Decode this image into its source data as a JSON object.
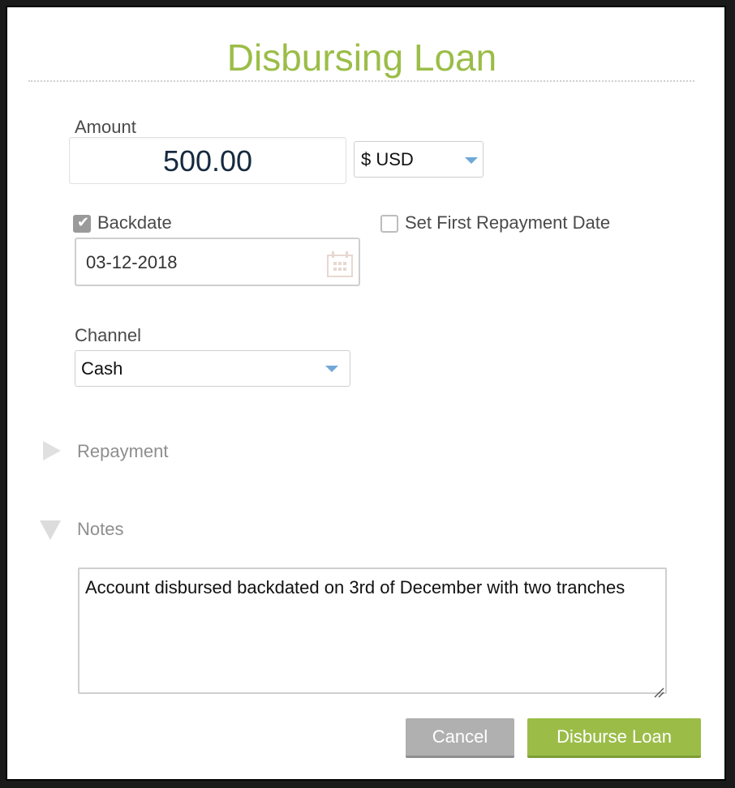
{
  "dialog": {
    "title": "Disbursing Loan"
  },
  "amount": {
    "label": "Amount",
    "value": "500.00"
  },
  "currency": {
    "selected": "$ USD"
  },
  "backdate": {
    "label": "Backdate",
    "checked": true,
    "value": "03-12-2018"
  },
  "first_repayment": {
    "label": "Set First Repayment Date",
    "checked": false
  },
  "channel": {
    "label": "Channel",
    "selected": "Cash"
  },
  "sections": {
    "repayment": {
      "label": "Repayment",
      "expanded": false
    },
    "notes": {
      "label": "Notes",
      "expanded": true
    }
  },
  "notes": {
    "value": "Account disbursed backdated on 3rd of December with two tranches"
  },
  "buttons": {
    "cancel": "Cancel",
    "disburse": "Disburse Loan"
  },
  "colors": {
    "accent": "#9bbd48",
    "cancel": "#b0b0b0",
    "caret": "#6fa8d8"
  }
}
